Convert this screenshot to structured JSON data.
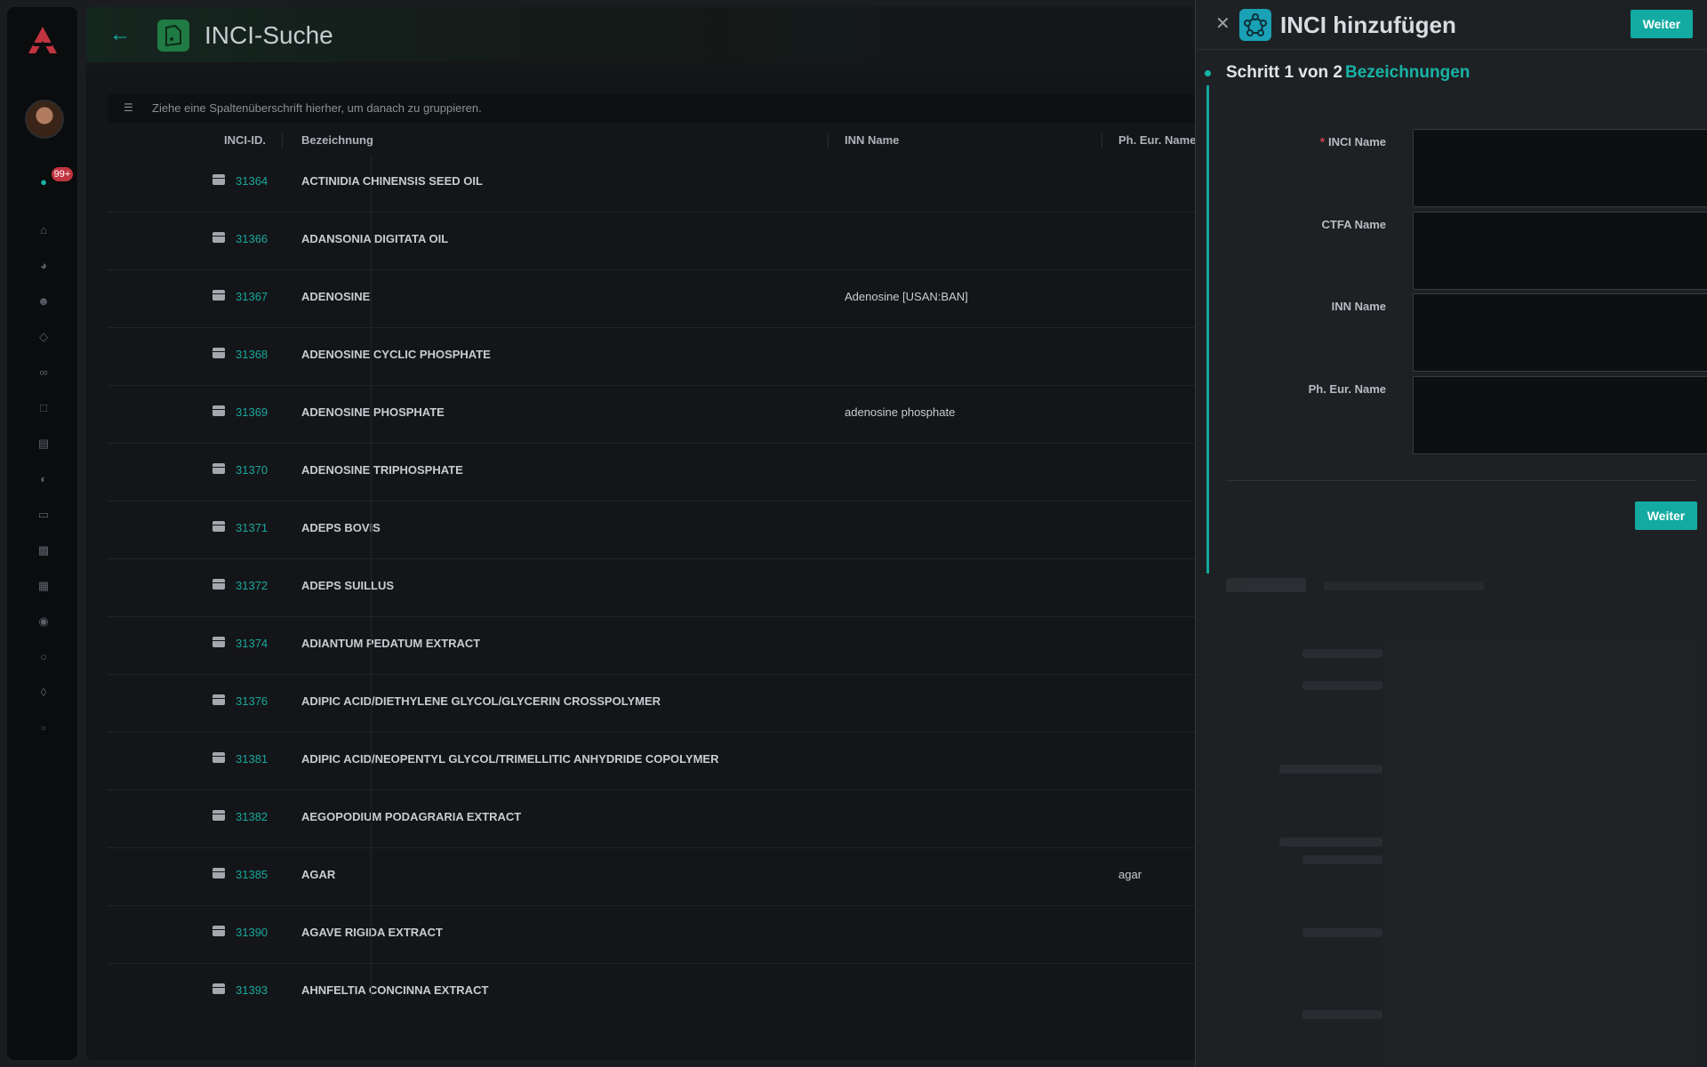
{
  "sidebar": {
    "notification_count": "99+",
    "icons": [
      "home-icon",
      "compass-icon",
      "users-icon",
      "tag-icon",
      "link-icon",
      "clipboard-icon",
      "warehouse-icon",
      "shield-half-icon",
      "folder-icon",
      "layers-icon",
      "archive-icon",
      "pin-icon",
      "shield-icon",
      "network-icon",
      "document-icon"
    ]
  },
  "header": {
    "title": "INCI-Suche"
  },
  "grid": {
    "group_hint": "Ziehe eine Spaltenüberschrift hierher, um danach zu gruppieren.",
    "columns": {
      "id": "INCI-ID.",
      "name": "Bezeichnung",
      "inn": "INN Name",
      "eur": "Ph. Eur. Name"
    },
    "rows": [
      {
        "id": "31364",
        "name": "ACTINIDIA CHINENSIS SEED OIL",
        "inn": "",
        "eur": ""
      },
      {
        "id": "31366",
        "name": "ADANSONIA DIGITATA OIL",
        "inn": "",
        "eur": ""
      },
      {
        "id": "31367",
        "name": "ADENOSINE",
        "inn": "Adenosine [USAN:BAN]",
        "eur": ""
      },
      {
        "id": "31368",
        "name": "ADENOSINE CYCLIC PHOSPHATE",
        "inn": "",
        "eur": ""
      },
      {
        "id": "31369",
        "name": "ADENOSINE PHOSPHATE",
        "inn": "adenosine phosphate",
        "eur": ""
      },
      {
        "id": "31370",
        "name": "ADENOSINE TRIPHOSPHATE",
        "inn": "",
        "eur": ""
      },
      {
        "id": "31371",
        "name": "ADEPS BOVIS",
        "inn": "",
        "eur": ""
      },
      {
        "id": "31372",
        "name": "ADEPS SUILLUS",
        "inn": "",
        "eur": ""
      },
      {
        "id": "31374",
        "name": "ADIANTUM PEDATUM EXTRACT",
        "inn": "",
        "eur": ""
      },
      {
        "id": "31376",
        "name": "ADIPIC ACID/DIETHYLENE GLYCOL/GLYCERIN CROSSPOLYMER",
        "inn": "",
        "eur": ""
      },
      {
        "id": "31381",
        "name": "ADIPIC ACID/NEOPENTYL GLYCOL/TRIMELLITIC ANHYDRIDE COPOLYMER",
        "inn": "",
        "eur": ""
      },
      {
        "id": "31382",
        "name": "AEGOPODIUM PODAGRARIA EXTRACT",
        "inn": "",
        "eur": ""
      },
      {
        "id": "31385",
        "name": "AGAR",
        "inn": "",
        "eur": "agar"
      },
      {
        "id": "31390",
        "name": "AGAVE RIGIDA EXTRACT",
        "inn": "",
        "eur": ""
      },
      {
        "id": "31393",
        "name": "AHNFELTIA CONCINNA EXTRACT",
        "inn": "",
        "eur": ""
      }
    ]
  },
  "drawer": {
    "title": "INCI hinzufügen",
    "next_label": "Weiter",
    "step_label": "Schritt 1 von 2",
    "step_name": "Bezeichnungen",
    "required_mark": "*",
    "fields": {
      "inci": "INCI Name",
      "ctfa": "CTFA Name",
      "inn": "INN Name",
      "eur": "Ph. Eur. Name"
    },
    "bottom_next_label": "Weiter"
  },
  "colors": {
    "accent": "#13aaa1",
    "danger": "#c0343f"
  }
}
